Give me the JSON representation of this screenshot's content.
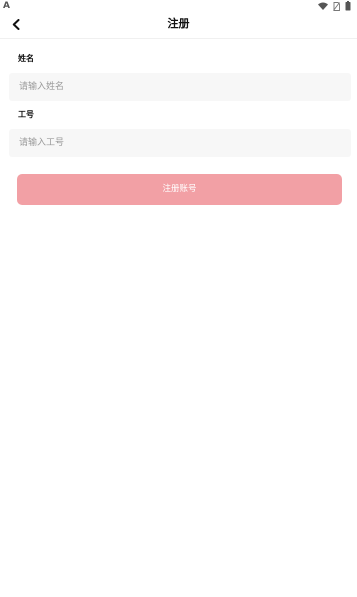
{
  "status_bar": {
    "left_indicator": "A",
    "icons": [
      "wifi-icon",
      "no-sim-icon",
      "battery-icon"
    ]
  },
  "header": {
    "title": "注册",
    "back_icon": "chevron-left-icon"
  },
  "form": {
    "name": {
      "label": "姓名",
      "value": "",
      "placeholder": "请输入姓名"
    },
    "employee_id": {
      "label": "工号",
      "value": "",
      "placeholder": "请输入工号"
    },
    "submit_label": "注册账号"
  },
  "colors": {
    "background": "#ffffff",
    "input_background": "#f7f7f7",
    "submit_button": "#f2a0a5",
    "title_text": "#111111",
    "placeholder_text": "#9a9a9a"
  }
}
